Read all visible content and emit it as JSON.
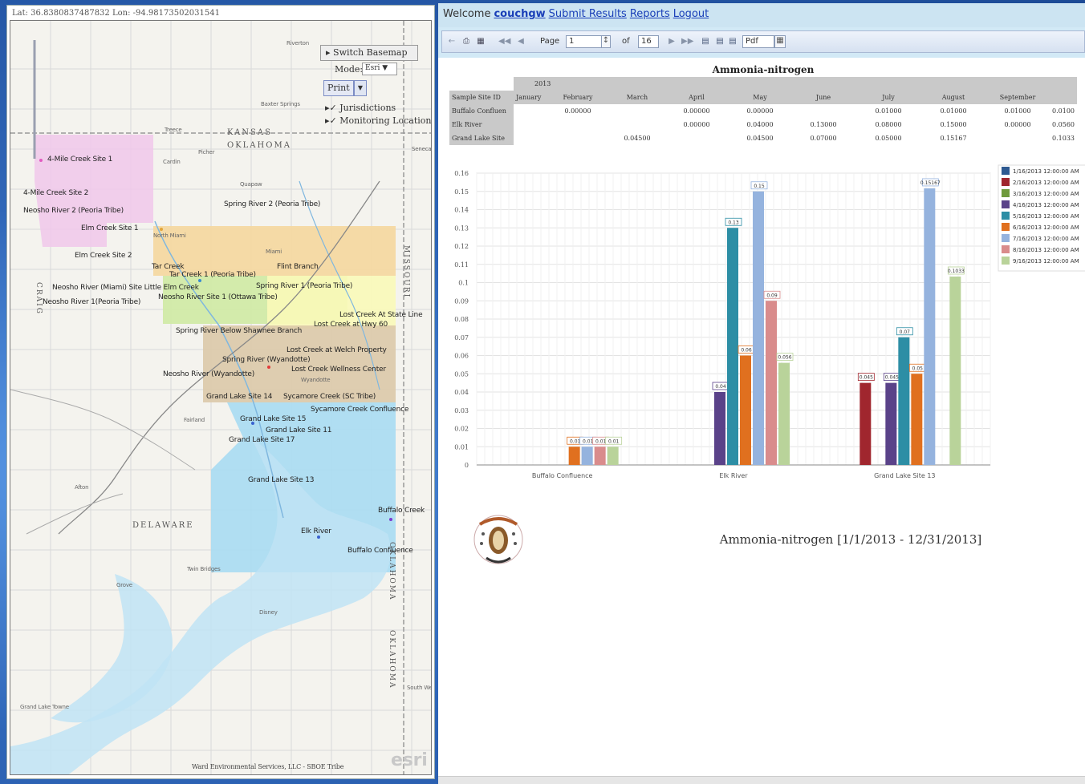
{
  "map": {
    "coords": "Lat: 36.8380837487832 Lon: -94.98173502031541",
    "controls": {
      "switch_basemap": "Switch Basemap",
      "mode_label": "Mode:",
      "mode_value": "Esri",
      "print_label": "Print",
      "layers": [
        "Jurisdictions",
        "Monitoring Locations"
      ]
    },
    "state_labels": [
      "KANSAS",
      "OKLAHOMA",
      "MISSOURI",
      "DELAWARE",
      "OKLAHOMA",
      "OKLAHOMA",
      "CRAIG"
    ],
    "site_labels": [
      "4-Mile Creek Site 1",
      "4-Mile Creek Site 2",
      "Neosho River 2 (Peoria Tribe)",
      "Elm Creek Site 1",
      "Elm Creek Site 2",
      "Spring River 2 (Peoria Tribe)",
      "Tar Creek",
      "Flint Branch",
      "Tar Creek 1 (Peoria Tribe)",
      "Neosho River (Miami) Site Little Elm Creek",
      "Spring River 1 (Peoria Tribe)",
      "Neosho River 1(Peoria Tribe)",
      "Neosho River Site 1 (Ottawa Tribe)",
      "Lost Creek At State Line",
      "Lost Creek at Hwy 60",
      "Spring River Below Shawnee Branch",
      "Lost Creek at Welch Property",
      "Spring River (Wyandotte)",
      "Lost Creek Wellness Center",
      "Neosho River (Wyandotte)",
      "Grand Lake Site 14",
      "Sycamore Creek (SC Tribe)",
      "Sycamore Creek Confluence",
      "Grand Lake Site 15",
      "Grand Lake Site 11",
      "Grand Lake Site 17",
      "Grand Lake Site 13",
      "Buffalo Creek",
      "Elk River",
      "Buffalo Confluence"
    ],
    "town_labels": [
      "Baxter Springs",
      "Riverton",
      "Treece",
      "Picher",
      "Cardin",
      "Quapaw",
      "Fairland",
      "Afton",
      "Grove",
      "Twin Bridges",
      "Grand Lake Towne",
      "South West City",
      "North Miami",
      "Miami",
      "Wyandotte",
      "Seneca",
      "Disney"
    ],
    "attribution": "Ward Environmental Services, LLC - SBOE Tribe",
    "esri_logo": "esri"
  },
  "report": {
    "welcome_text": "Welcome",
    "user": "couchgw",
    "links": [
      "Submit Results",
      "Reports",
      "Logout"
    ],
    "toolbar": {
      "page_label": "Page",
      "page_value": "1",
      "of_label": "of",
      "total_pages": "16",
      "format_value": "Pdf"
    },
    "title": "Ammonia-nitrogen",
    "table": {
      "year": "2013",
      "corner": "Sample Site ID",
      "months": [
        "January",
        "February",
        "March",
        "April",
        "May",
        "June",
        "July",
        "August",
        "September"
      ],
      "rows": [
        {
          "site": "Buffalo Confluen",
          "cells": [
            "",
            "0.00000",
            "",
            "0.00000",
            "0.00000",
            "",
            "0.01000",
            "0.01000",
            "0.01000",
            "0.0100"
          ]
        },
        {
          "site": "Elk River",
          "cells": [
            "",
            "",
            "",
            "0.00000",
            "0.04000",
            "0.13000",
            "0.08000",
            "0.15000",
            "0.00000",
            "0.0560"
          ]
        },
        {
          "site": "Grand Lake Site",
          "cells": [
            "",
            "",
            "0.04500",
            "",
            "0.04500",
            "0.07000",
            "0.05000",
            "0.15167",
            "",
            "0.1033"
          ]
        }
      ]
    },
    "caption": "Ammonia-nitrogen [1/1/2013 - 12/31/2013]"
  },
  "chart_data": {
    "type": "bar",
    "title": "",
    "xlabel": "",
    "ylabel": "",
    "ylim": [
      0,
      0.16
    ],
    "yticks": [
      "0",
      "0.01",
      "0.02",
      "0.03",
      "0.04",
      "0.05",
      "0.06",
      "0.07",
      "0.08",
      "0.09",
      "0.1",
      "0.11",
      "0.12",
      "0.13",
      "0.14",
      "0.15",
      "0.16"
    ],
    "categories": [
      "Buffalo Confluence",
      "Elk River",
      "Grand Lake Site 13"
    ],
    "legend_position": "right",
    "series": [
      {
        "name": "1/16/2013 12:00:00 AM",
        "color": "#2e5a91",
        "values": [
          null,
          null,
          null
        ]
      },
      {
        "name": "2/16/2013 12:00:00 AM",
        "color": "#a0262e",
        "values": [
          null,
          null,
          0.045
        ]
      },
      {
        "name": "3/16/2013 12:00:00 AM",
        "color": "#6f9a3c",
        "values": [
          null,
          null,
          null
        ]
      },
      {
        "name": "4/16/2013 12:00:00 AM",
        "color": "#5a4289",
        "values": [
          null,
          0.04,
          0.045
        ]
      },
      {
        "name": "5/16/2013 12:00:00 AM",
        "color": "#2d8ea5",
        "values": [
          null,
          0.13,
          0.07
        ]
      },
      {
        "name": "6/16/2013 12:00:00 AM",
        "color": "#e0701f",
        "values": [
          0.01,
          0.06,
          0.05
        ]
      },
      {
        "name": "7/16/2013 12:00:00 AM",
        "color": "#95b3de",
        "values": [
          0.01,
          0.15,
          0.15167
        ]
      },
      {
        "name": "8/16/2013 12:00:00 AM",
        "color": "#d98c8c",
        "values": [
          0.01,
          0.09,
          null
        ]
      },
      {
        "name": "9/16/2013 12:00:00 AM",
        "color": "#b9d39a",
        "values": [
          0.01,
          0.056,
          0.1033
        ]
      }
    ]
  }
}
